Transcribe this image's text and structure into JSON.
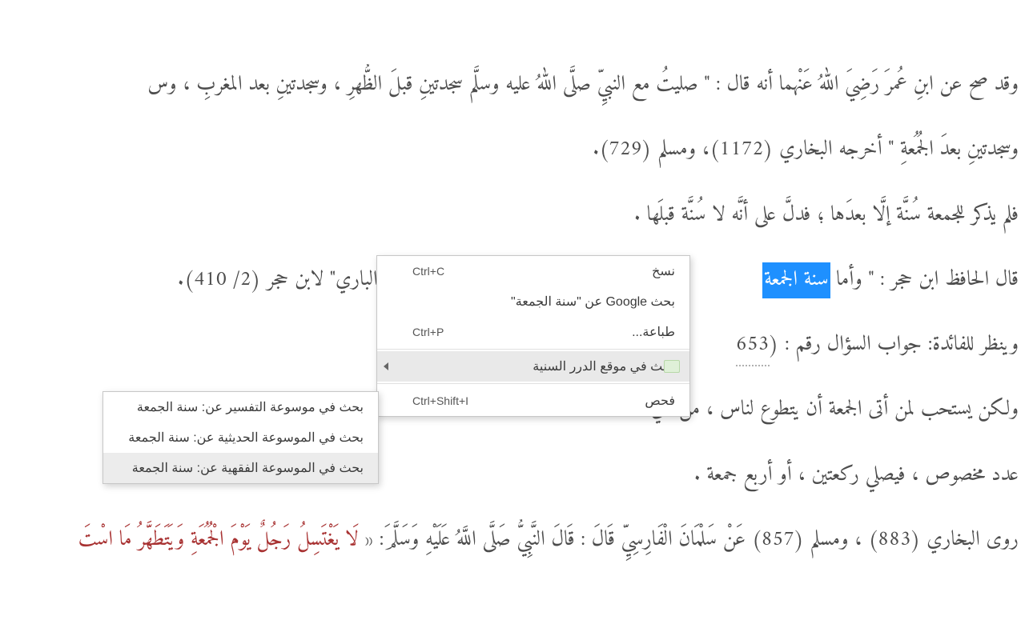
{
  "content": {
    "p1": "وقد صح عن ابنِ عُمرَ رَضِيَ اللهُ عَنْهما أنه قال : \" صليتُ مع النبيِّ صلَّى اللهُ عليه وسلَّم سجدتينِ قبلَ الظُّهرِ ، وسجدتينِ بعد المغربِ ، وس",
    "p2": "وسجدتينِ بعدَ الجُمُعةِ \" أخرجه البخاري (1172)، ومسلم (729).",
    "p3": "فلم يذكر للجمعة سُنَّة إلَّا بعدَها ؛ فدلَّ على أنَّه لا سُنَّة قبلَها .",
    "p4_prefix": "قال الحافظ ابن حجر : \" وأما ",
    "p4_selected": "سنة الجمعة",
    "p4_suffix_end": " \"فتح الباري\" لابن حجر (2/ 410).",
    "p5_prefix": "وينظر للفائدة: جواب السؤال رقم : (",
    "p5_link": "653",
    "p6": "ولكن يستحب لمن أتى الجمعة أن يتطوع                                                                           لناس ، من غي",
    "p7": "عدد مخصوص ، فيصلي ركعتين ، أو أربع                                                                           جمعة .",
    "p8_prefix": "روى البخاري (883) ، ومسلم (857) عَنْ سَلْمَانَ الْفَارِسِيِّ قَالَ : قَالَ النَّبِيُّ صَلَّى اللَّهُ عَلَيْهِ وَسَلَّمَ: « ",
    "p8_red": "لَا يَغْتَسِلُ رَجُلٌ يَوْمَ الْجُمُعَةِ وَيَتَطَهَّرُ مَا اسْتَ"
  },
  "menu": {
    "copy": {
      "label": "نسخ",
      "shortcut": "Ctrl+C"
    },
    "google": {
      "label": "بحث Google عن \"سنة الجمعة\""
    },
    "print": {
      "label": "طباعة...",
      "shortcut": "Ctrl+P"
    },
    "dorar": {
      "label": "ابحث في موقع الدرر السنية"
    },
    "inspect": {
      "label": "فحص",
      "shortcut": "Ctrl+Shift+I"
    }
  },
  "submenu": {
    "tafsir": "بحث في موسوعة التفسير عن: سنة الجمعة",
    "hadith": "بحث في الموسوعة الحديثية عن: سنة الجمعة",
    "fiqh": "بحث في الموسوعة الفقهية عن: سنة الجمعة"
  }
}
